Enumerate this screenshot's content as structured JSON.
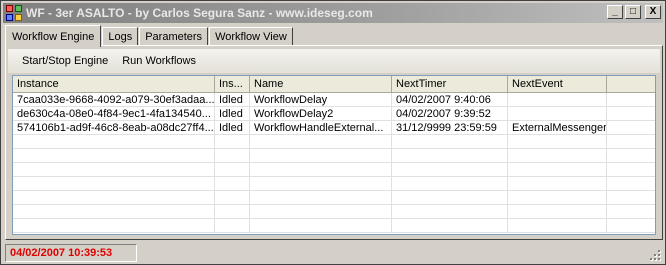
{
  "window": {
    "title": "WF - 3er ASALTO - by Carlos Segura Sanz - www.ideseg.com",
    "buttons": {
      "minimize": "_",
      "maximize": "□",
      "close": "X"
    }
  },
  "tabs": [
    "Workflow Engine",
    "Logs",
    "Parameters",
    "Workflow View"
  ],
  "toolbar": {
    "start_stop": "Start/Stop Engine",
    "run": "Run Workflows"
  },
  "grid": {
    "columns": [
      "Instance",
      "Ins...",
      "Name",
      "NextTimer",
      "NextEvent",
      ""
    ],
    "rows": [
      [
        "7caa033e-9668-4092-a079-30ef3adaa...",
        "Idled",
        "WorkflowDelay",
        "04/02/2007 9:40:06",
        "",
        ""
      ],
      [
        "de630c4a-08e0-4f84-9ec1-4fa134540...",
        "Idled",
        "WorkflowDelay2",
        "04/02/2007 9:39:52",
        "",
        ""
      ],
      [
        "574106b1-ad9f-46c8-8eab-a08dc27ff4...",
        "Idled",
        "WorkflowHandleExternal...",
        "31/12/9999 23:59:59",
        "ExternalMessenger",
        ""
      ]
    ],
    "empty_rows": 7
  },
  "status": {
    "datetime": "04/02/2007 10:39:53"
  },
  "colors": {
    "status_text": "#e00000",
    "titlebar_inactive": "#808080",
    "grid_border": "#7f9db9"
  }
}
